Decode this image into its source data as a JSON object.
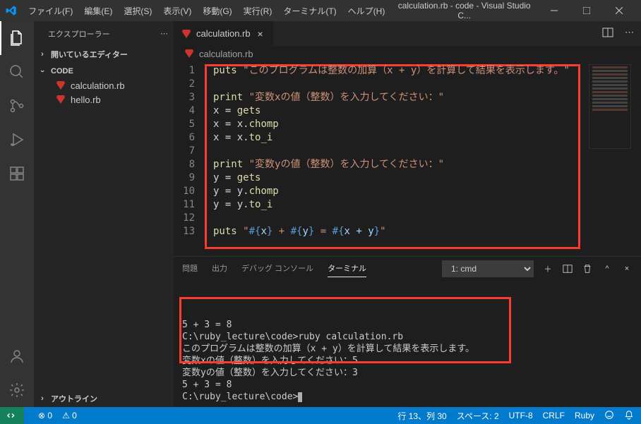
{
  "titlebar": {
    "menus": [
      "ファイル(F)",
      "編集(E)",
      "選択(S)",
      "表示(V)",
      "移動(G)",
      "実行(R)",
      "ターミナル(T)",
      "ヘルプ(H)"
    ],
    "title": "calculation.rb - code - Visual Studio C..."
  },
  "sidebar": {
    "header": "エクスプローラー",
    "sections": {
      "open_editors": "開いているエディター",
      "folder": "CODE",
      "outline": "アウトライン"
    },
    "files": [
      "calculation.rb",
      "hello.rb"
    ]
  },
  "tabs": {
    "active": "calculation.rb"
  },
  "breadcrumb": "calculation.rb",
  "code_lines": [
    {
      "n": "1",
      "html": "<span class='kw'>puts</span> <span class='str'>\"このプログラムは整数の加算（x + y）を計算して結果を表示します。\"</span>"
    },
    {
      "n": "2",
      "html": ""
    },
    {
      "n": "3",
      "html": "<span class='kw'>print</span> <span class='str'>\"変数xの値（整数）を入力してください：\"</span>"
    },
    {
      "n": "4",
      "html": "x <span class='op'>=</span> <span class='kw'>gets</span>"
    },
    {
      "n": "5",
      "html": "x <span class='op'>=</span> x.<span class='kw'>chomp</span>"
    },
    {
      "n": "6",
      "html": "x <span class='op'>=</span> x.<span class='kw'>to_i</span>"
    },
    {
      "n": "7",
      "html": ""
    },
    {
      "n": "8",
      "html": "<span class='kw'>print</span> <span class='str'>\"変数yの値（整数）を入力してください：\"</span>"
    },
    {
      "n": "9",
      "html": "y <span class='op'>=</span> <span class='kw'>gets</span>"
    },
    {
      "n": "10",
      "html": "y <span class='op'>=</span> y.<span class='kw'>chomp</span>"
    },
    {
      "n": "11",
      "html": "y <span class='op'>=</span> y.<span class='kw'>to_i</span>"
    },
    {
      "n": "12",
      "html": ""
    },
    {
      "n": "13",
      "html": "<span class='kw'>puts</span> <span class='str'>\"</span><span class='punct'>#{</span><span class='int'>x</span><span class='punct'>}</span><span class='str'> + </span><span class='punct'>#{</span><span class='int'>y</span><span class='punct'>}</span><span class='str'> = </span><span class='punct'>#{</span><span class='int'>x + y</span><span class='punct'>}</span><span class='str'>\"</span>"
    }
  ],
  "panel": {
    "tabs": [
      "問題",
      "出力",
      "デバッグ コンソール",
      "ターミナル"
    ],
    "terminal_name": "1: cmd"
  },
  "terminal_lines": [
    "5 + 3 = 8",
    "",
    "C:\\ruby_lecture\\code>ruby calculation.rb",
    "このプログラムは整数の加算（x + y）を計算して結果を表示します。",
    "変数xの値（整数）を入力してください：5",
    "変数yの値（整数）を入力してください：3",
    "5 + 3 = 8",
    "",
    "C:\\ruby_lecture\\code>"
  ],
  "statusbar": {
    "errors": "0",
    "warnings": "0",
    "ln_col": "行 13、列 30",
    "spaces": "スペース: 2",
    "encoding": "UTF-8",
    "eol": "CRLF",
    "lang": "Ruby"
  }
}
